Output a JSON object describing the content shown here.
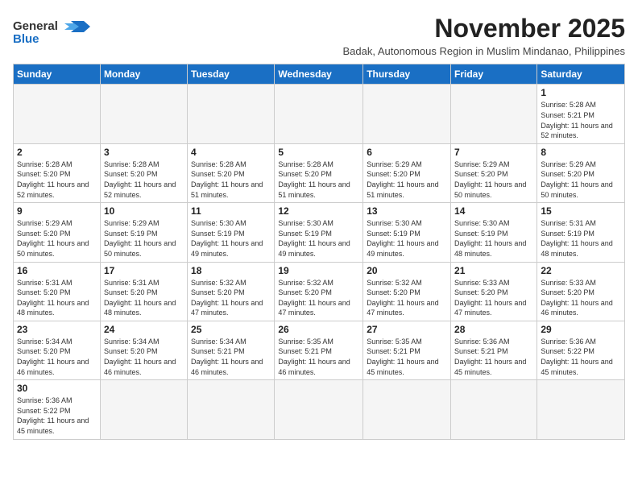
{
  "logo": {
    "line1": "General",
    "line2": "Blue",
    "tagline": ""
  },
  "header": {
    "month": "November 2025",
    "subtitle": "Badak, Autonomous Region in Muslim Mindanao, Philippines"
  },
  "weekdays": [
    "Sunday",
    "Monday",
    "Tuesday",
    "Wednesday",
    "Thursday",
    "Friday",
    "Saturday"
  ],
  "days": [
    {
      "date": "",
      "sunrise": "",
      "sunset": "",
      "daylight": ""
    },
    {
      "date": "",
      "sunrise": "",
      "sunset": "",
      "daylight": ""
    },
    {
      "date": "",
      "sunrise": "",
      "sunset": "",
      "daylight": ""
    },
    {
      "date": "",
      "sunrise": "",
      "sunset": "",
      "daylight": ""
    },
    {
      "date": "",
      "sunrise": "",
      "sunset": "",
      "daylight": ""
    },
    {
      "date": "",
      "sunrise": "",
      "sunset": "",
      "daylight": ""
    },
    {
      "date": "1",
      "sunrise": "Sunrise: 5:28 AM",
      "sunset": "Sunset: 5:21 PM",
      "daylight": "Daylight: 11 hours and 52 minutes."
    },
    {
      "date": "2",
      "sunrise": "Sunrise: 5:28 AM",
      "sunset": "Sunset: 5:20 PM",
      "daylight": "Daylight: 11 hours and 52 minutes."
    },
    {
      "date": "3",
      "sunrise": "Sunrise: 5:28 AM",
      "sunset": "Sunset: 5:20 PM",
      "daylight": "Daylight: 11 hours and 52 minutes."
    },
    {
      "date": "4",
      "sunrise": "Sunrise: 5:28 AM",
      "sunset": "Sunset: 5:20 PM",
      "daylight": "Daylight: 11 hours and 51 minutes."
    },
    {
      "date": "5",
      "sunrise": "Sunrise: 5:28 AM",
      "sunset": "Sunset: 5:20 PM",
      "daylight": "Daylight: 11 hours and 51 minutes."
    },
    {
      "date": "6",
      "sunrise": "Sunrise: 5:29 AM",
      "sunset": "Sunset: 5:20 PM",
      "daylight": "Daylight: 11 hours and 51 minutes."
    },
    {
      "date": "7",
      "sunrise": "Sunrise: 5:29 AM",
      "sunset": "Sunset: 5:20 PM",
      "daylight": "Daylight: 11 hours and 50 minutes."
    },
    {
      "date": "8",
      "sunrise": "Sunrise: 5:29 AM",
      "sunset": "Sunset: 5:20 PM",
      "daylight": "Daylight: 11 hours and 50 minutes."
    },
    {
      "date": "9",
      "sunrise": "Sunrise: 5:29 AM",
      "sunset": "Sunset: 5:20 PM",
      "daylight": "Daylight: 11 hours and 50 minutes."
    },
    {
      "date": "10",
      "sunrise": "Sunrise: 5:29 AM",
      "sunset": "Sunset: 5:19 PM",
      "daylight": "Daylight: 11 hours and 50 minutes."
    },
    {
      "date": "11",
      "sunrise": "Sunrise: 5:30 AM",
      "sunset": "Sunset: 5:19 PM",
      "daylight": "Daylight: 11 hours and 49 minutes."
    },
    {
      "date": "12",
      "sunrise": "Sunrise: 5:30 AM",
      "sunset": "Sunset: 5:19 PM",
      "daylight": "Daylight: 11 hours and 49 minutes."
    },
    {
      "date": "13",
      "sunrise": "Sunrise: 5:30 AM",
      "sunset": "Sunset: 5:19 PM",
      "daylight": "Daylight: 11 hours and 49 minutes."
    },
    {
      "date": "14",
      "sunrise": "Sunrise: 5:30 AM",
      "sunset": "Sunset: 5:19 PM",
      "daylight": "Daylight: 11 hours and 48 minutes."
    },
    {
      "date": "15",
      "sunrise": "Sunrise: 5:31 AM",
      "sunset": "Sunset: 5:19 PM",
      "daylight": "Daylight: 11 hours and 48 minutes."
    },
    {
      "date": "16",
      "sunrise": "Sunrise: 5:31 AM",
      "sunset": "Sunset: 5:20 PM",
      "daylight": "Daylight: 11 hours and 48 minutes."
    },
    {
      "date": "17",
      "sunrise": "Sunrise: 5:31 AM",
      "sunset": "Sunset: 5:20 PM",
      "daylight": "Daylight: 11 hours and 48 minutes."
    },
    {
      "date": "18",
      "sunrise": "Sunrise: 5:32 AM",
      "sunset": "Sunset: 5:20 PM",
      "daylight": "Daylight: 11 hours and 47 minutes."
    },
    {
      "date": "19",
      "sunrise": "Sunrise: 5:32 AM",
      "sunset": "Sunset: 5:20 PM",
      "daylight": "Daylight: 11 hours and 47 minutes."
    },
    {
      "date": "20",
      "sunrise": "Sunrise: 5:32 AM",
      "sunset": "Sunset: 5:20 PM",
      "daylight": "Daylight: 11 hours and 47 minutes."
    },
    {
      "date": "21",
      "sunrise": "Sunrise: 5:33 AM",
      "sunset": "Sunset: 5:20 PM",
      "daylight": "Daylight: 11 hours and 47 minutes."
    },
    {
      "date": "22",
      "sunrise": "Sunrise: 5:33 AM",
      "sunset": "Sunset: 5:20 PM",
      "daylight": "Daylight: 11 hours and 46 minutes."
    },
    {
      "date": "23",
      "sunrise": "Sunrise: 5:34 AM",
      "sunset": "Sunset: 5:20 PM",
      "daylight": "Daylight: 11 hours and 46 minutes."
    },
    {
      "date": "24",
      "sunrise": "Sunrise: 5:34 AM",
      "sunset": "Sunset: 5:20 PM",
      "daylight": "Daylight: 11 hours and 46 minutes."
    },
    {
      "date": "25",
      "sunrise": "Sunrise: 5:34 AM",
      "sunset": "Sunset: 5:21 PM",
      "daylight": "Daylight: 11 hours and 46 minutes."
    },
    {
      "date": "26",
      "sunrise": "Sunrise: 5:35 AM",
      "sunset": "Sunset: 5:21 PM",
      "daylight": "Daylight: 11 hours and 46 minutes."
    },
    {
      "date": "27",
      "sunrise": "Sunrise: 5:35 AM",
      "sunset": "Sunset: 5:21 PM",
      "daylight": "Daylight: 11 hours and 45 minutes."
    },
    {
      "date": "28",
      "sunrise": "Sunrise: 5:36 AM",
      "sunset": "Sunset: 5:21 PM",
      "daylight": "Daylight: 11 hours and 45 minutes."
    },
    {
      "date": "29",
      "sunrise": "Sunrise: 5:36 AM",
      "sunset": "Sunset: 5:22 PM",
      "daylight": "Daylight: 11 hours and 45 minutes."
    },
    {
      "date": "30",
      "sunrise": "Sunrise: 5:36 AM",
      "sunset": "Sunset: 5:22 PM",
      "daylight": "Daylight: 11 hours and 45 minutes."
    }
  ]
}
